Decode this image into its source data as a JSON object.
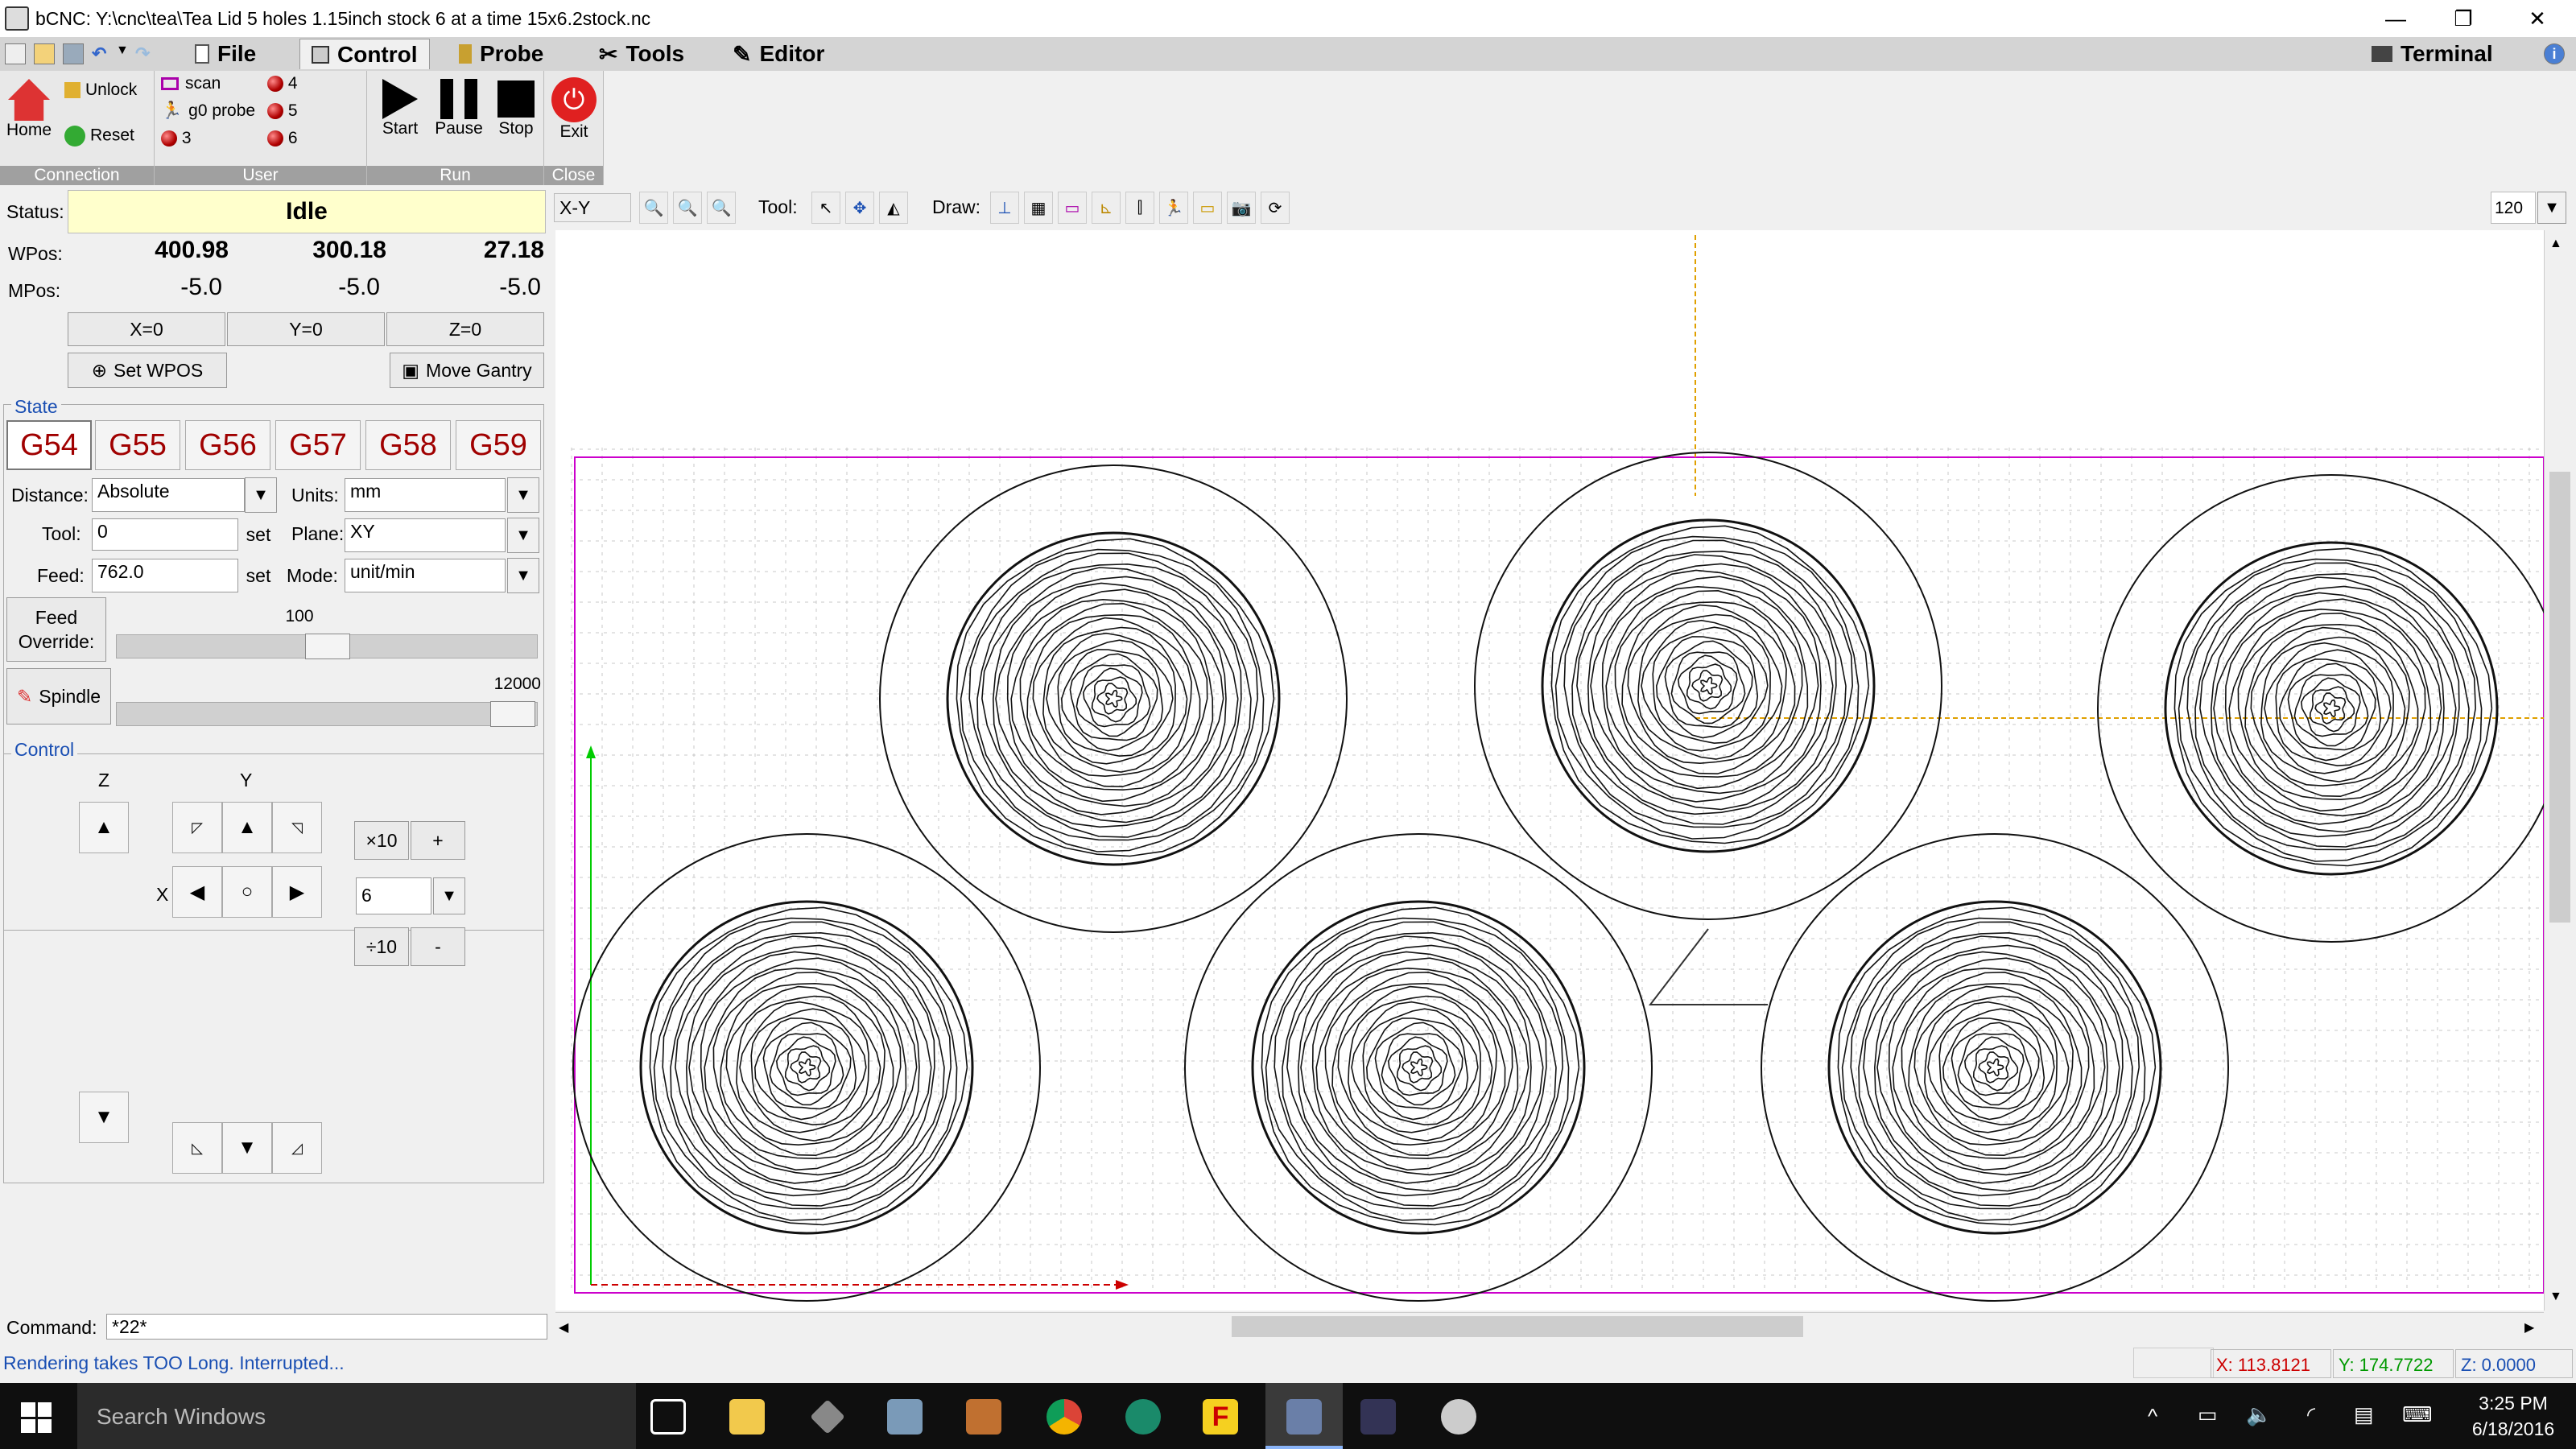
{
  "window": {
    "title": "bCNC: Y:\\cnc\\tea\\Tea Lid 5 holes 1.15inch stock 6 at a time 15x6.2stock.nc"
  },
  "menu": {
    "tabs": [
      "File",
      "Control",
      "Probe",
      "Tools",
      "Editor"
    ],
    "active": "Control",
    "terminal": "Terminal"
  },
  "ribbon": {
    "connection": {
      "home": "Home",
      "unlock": "Unlock",
      "reset": "Reset",
      "label": "Connection"
    },
    "user": {
      "scan": "scan",
      "g0probe": "g0 probe",
      "b3": "3",
      "b4": "4",
      "b5": "5",
      "b6": "6",
      "label": "User"
    },
    "run": {
      "start": "Start",
      "pause": "Pause",
      "stop": "Stop",
      "label": "Run"
    },
    "close": {
      "exit": "Exit",
      "label": "Close"
    }
  },
  "status": {
    "label": "Status:",
    "state": "Idle",
    "wpos_label": "WPos:",
    "wpos": [
      "400.98",
      "300.18",
      "27.18"
    ],
    "mpos_label": "MPos:",
    "mpos": [
      "-5.0",
      "-5.0",
      "-5.0"
    ],
    "zero_buttons": [
      "X=0",
      "Y=0",
      "Z=0"
    ],
    "set_wpos": "Set WPOS",
    "move_gantry": "Move Gantry"
  },
  "state": {
    "label": "State",
    "wcs": [
      "G54",
      "G55",
      "G56",
      "G57",
      "G58",
      "G59"
    ],
    "selected": "G54",
    "distance_label": "Distance:",
    "distance": "Absolute",
    "units_label": "Units:",
    "units": "mm",
    "tool_label": "Tool:",
    "tool": "0",
    "set": "set",
    "plane_label": "Plane:",
    "plane": "XY",
    "feed_label": "Feed:",
    "feed": "762.0",
    "mode_label": "Mode:",
    "mode": "unit/min",
    "feed_override_label": "Feed\nOverride:",
    "feed_override": "100",
    "feed_override_fraction": 0.5,
    "spindle_label": "Spindle",
    "spindle_value": "12000",
    "spindle_fraction": 1.0
  },
  "control": {
    "label": "Control",
    "z_label": "Z",
    "y_label": "Y",
    "x_label": "X",
    "x10": "×10",
    "plus": "+",
    "div10": "÷10",
    "minus": "-",
    "step": "6"
  },
  "canvas_toolbar": {
    "view": "X-Y",
    "tool_label": "Tool:",
    "draw_label": "Draw:",
    "zoom": "120"
  },
  "command": {
    "label": "Command:",
    "value": "*22*"
  },
  "statusbar": {
    "message": "Rendering takes TOO Long. Interrupted...",
    "x": "X: 113.8121",
    "y": "Y: 174.7722",
    "z": "Z: 0.0000"
  },
  "taskbar": {
    "search": "Search Windows",
    "time": "3:25 PM",
    "date": "6/18/2016"
  },
  "colors": {
    "idle_bg": "#ffffcc",
    "wcs_text": "#a00000",
    "status_text": "#1a4fb3",
    "margin_line": "#cc00cc",
    "axis_y": "#00cc00",
    "axis_x": "#cc0000",
    "crosshair": "#e0a000"
  }
}
